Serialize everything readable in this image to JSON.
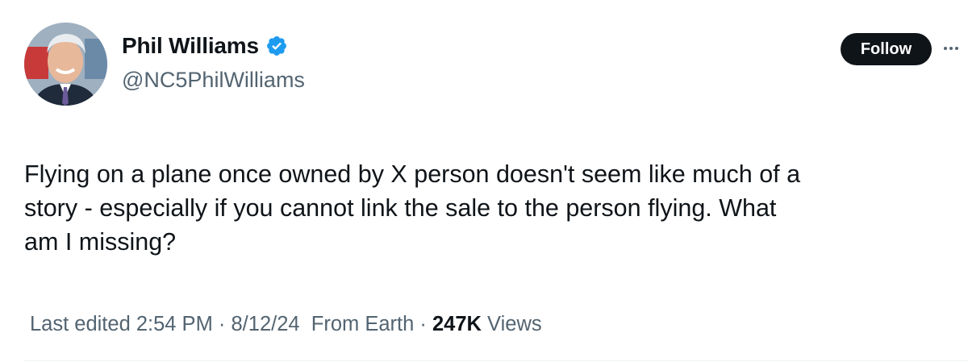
{
  "author": {
    "display_name": "Phil Williams",
    "handle": "@NC5PhilWilliams",
    "verified": true,
    "verified_color": "#1d9bf0"
  },
  "actions": {
    "follow_label": "Follow",
    "more_icon": "more-horizontal-icon"
  },
  "tweet": {
    "line1": "Flying on a plane once owned by X person doesn't seem like much of a",
    "line2": "story - especially if you cannot link the sale to the person flying. What",
    "line3": "am I missing?"
  },
  "meta": {
    "edited_time": "Last edited 2:54 PM",
    "separator1": "·",
    "date": "8/12/24",
    "location": "From Earth",
    "separator2": "·",
    "views_count": "247K",
    "views_label": "Views"
  },
  "colors": {
    "text_primary": "#0f1419",
    "text_secondary": "#536471",
    "follow_bg": "#0f1419",
    "divider": "#eff3f4"
  }
}
